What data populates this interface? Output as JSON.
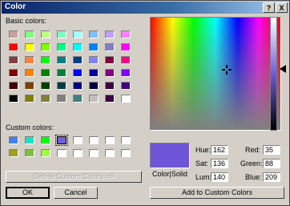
{
  "window": {
    "title": "Color",
    "help_label": "?",
    "close_label": "X"
  },
  "labels": {
    "basic_colors": "Basic colors:",
    "custom_colors": "Custom colors:",
    "color_solid": "Color|Solid",
    "hue": "Hue:",
    "sat": "Sat:",
    "lum": "Lum:",
    "red": "Red:",
    "green": "Green:",
    "blue": "Blue:"
  },
  "values": {
    "hue": "162",
    "sat": "136",
    "lum": "140",
    "red": "35",
    "green": "88",
    "blue": "209"
  },
  "buttons": {
    "define_custom": "Define Custom Colors >>",
    "ok": "OK",
    "cancel": "Cancel",
    "add_custom": "Add to Custom Colors"
  },
  "basic_colors": [
    [
      "#c8a0a0",
      "#80ff80",
      "#c0ff80",
      "#80ffc0",
      "#a0ffff",
      "#80c0ff",
      "#c0a0ff",
      "#ff80ff"
    ],
    [
      "#ff0000",
      "#ffff00",
      "#80ff00",
      "#00ff80",
      "#00ffff",
      "#0080ff",
      "#8080c0",
      "#ff00ff"
    ],
    [
      "#804040",
      "#ff8040",
      "#00ff00",
      "#008080",
      "#004080",
      "#8080ff",
      "#800040",
      "#ff0080"
    ],
    [
      "#800000",
      "#ff8000",
      "#008000",
      "#008040",
      "#0000ff",
      "#0000a0",
      "#800080",
      "#8000ff"
    ],
    [
      "#400000",
      "#804000",
      "#004000",
      "#004040",
      "#000080",
      "#000040",
      "#400040",
      "#400080"
    ],
    [
      "#000000",
      "#808000",
      "#808040",
      "#808080",
      "#408080",
      "#c0c0c0",
      "#400040",
      "#ffffff"
    ]
  ],
  "custom_colors": [
    [
      "#4080ff",
      "#20e0c0",
      "#00ff00",
      "#7060e0",
      "#ffffff",
      "#ffffff",
      "#ffffff",
      "#ffffff"
    ],
    [
      "#a0a020",
      "#80c040",
      "#a0ff40",
      "#ffffff",
      "#ffffff",
      "#ffffff",
      "#ffffff",
      "#ffffff"
    ]
  ],
  "colors": {
    "current": "#6e55d8"
  }
}
